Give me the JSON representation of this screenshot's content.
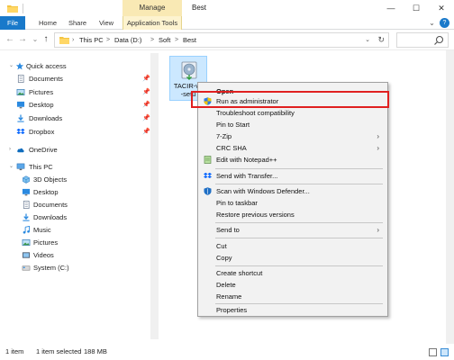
{
  "window": {
    "title": "Best",
    "context_tab": "Manage",
    "minimize": "—",
    "maximize": "☐",
    "close": "✕"
  },
  "ribbon": {
    "tabs": [
      "File",
      "Home",
      "Share",
      "View",
      "Application Tools"
    ],
    "expand": "⌄",
    "help": "?"
  },
  "address": {
    "back": "←",
    "forward": "→",
    "recent": "⌄",
    "up": "↑",
    "crumbs": [
      "This PC",
      "Data (D:)",
      "Soft",
      "Best"
    ],
    "sep": ">",
    "lead_sep": "›",
    "dropdown": "⌄",
    "refresh": "↻"
  },
  "nav": {
    "quick_access": "Quick access",
    "quick_items": [
      "Documents",
      "Pictures",
      "Desktop",
      "Downloads",
      "Dropbox"
    ],
    "pin": "📌",
    "onedrive": "OneDrive",
    "thispc": "This PC",
    "pc_items": [
      "3D Objects",
      "Desktop",
      "Documents",
      "Downloads",
      "Music",
      "Pictures",
      "Videos",
      "System (C:)"
    ],
    "chevron_open": "⌄",
    "chevron_closed": "›"
  },
  "file": {
    "name_line1": "TACIR-v4",
    "name_line2": "-setu"
  },
  "context_menu": {
    "items": [
      {
        "label": "Open",
        "bold": true
      },
      {
        "label": "Run as administrator",
        "icon": "shield-icon"
      },
      {
        "label": "Troubleshoot compatibility"
      },
      {
        "label": "Pin to Start"
      },
      {
        "label": "7-Zip",
        "submenu": true
      },
      {
        "label": "CRC SHA",
        "submenu": true
      },
      {
        "label": "Edit with Notepad++",
        "icon": "notepad-icon"
      },
      {
        "label": "Send with Transfer...",
        "icon": "dropbox-icon"
      },
      {
        "label": "Scan with Windows Defender...",
        "icon": "defender-icon"
      },
      {
        "label": "Pin to taskbar"
      },
      {
        "label": "Restore previous versions"
      },
      {
        "label": "Send to",
        "submenu": true
      },
      {
        "label": "Cut"
      },
      {
        "label": "Copy"
      },
      {
        "label": "Create shortcut"
      },
      {
        "label": "Delete"
      },
      {
        "label": "Rename"
      },
      {
        "label": "Properties"
      }
    ],
    "submenu_arrow": "›"
  },
  "status": {
    "count": "1 item",
    "selected": "1 item selected",
    "size": "188 MB"
  },
  "colors": {
    "file_tab": "#1979ca",
    "manage_tab": "#f9e9b4",
    "selection": "#cce8ff",
    "highlight_border": "#e02020"
  }
}
